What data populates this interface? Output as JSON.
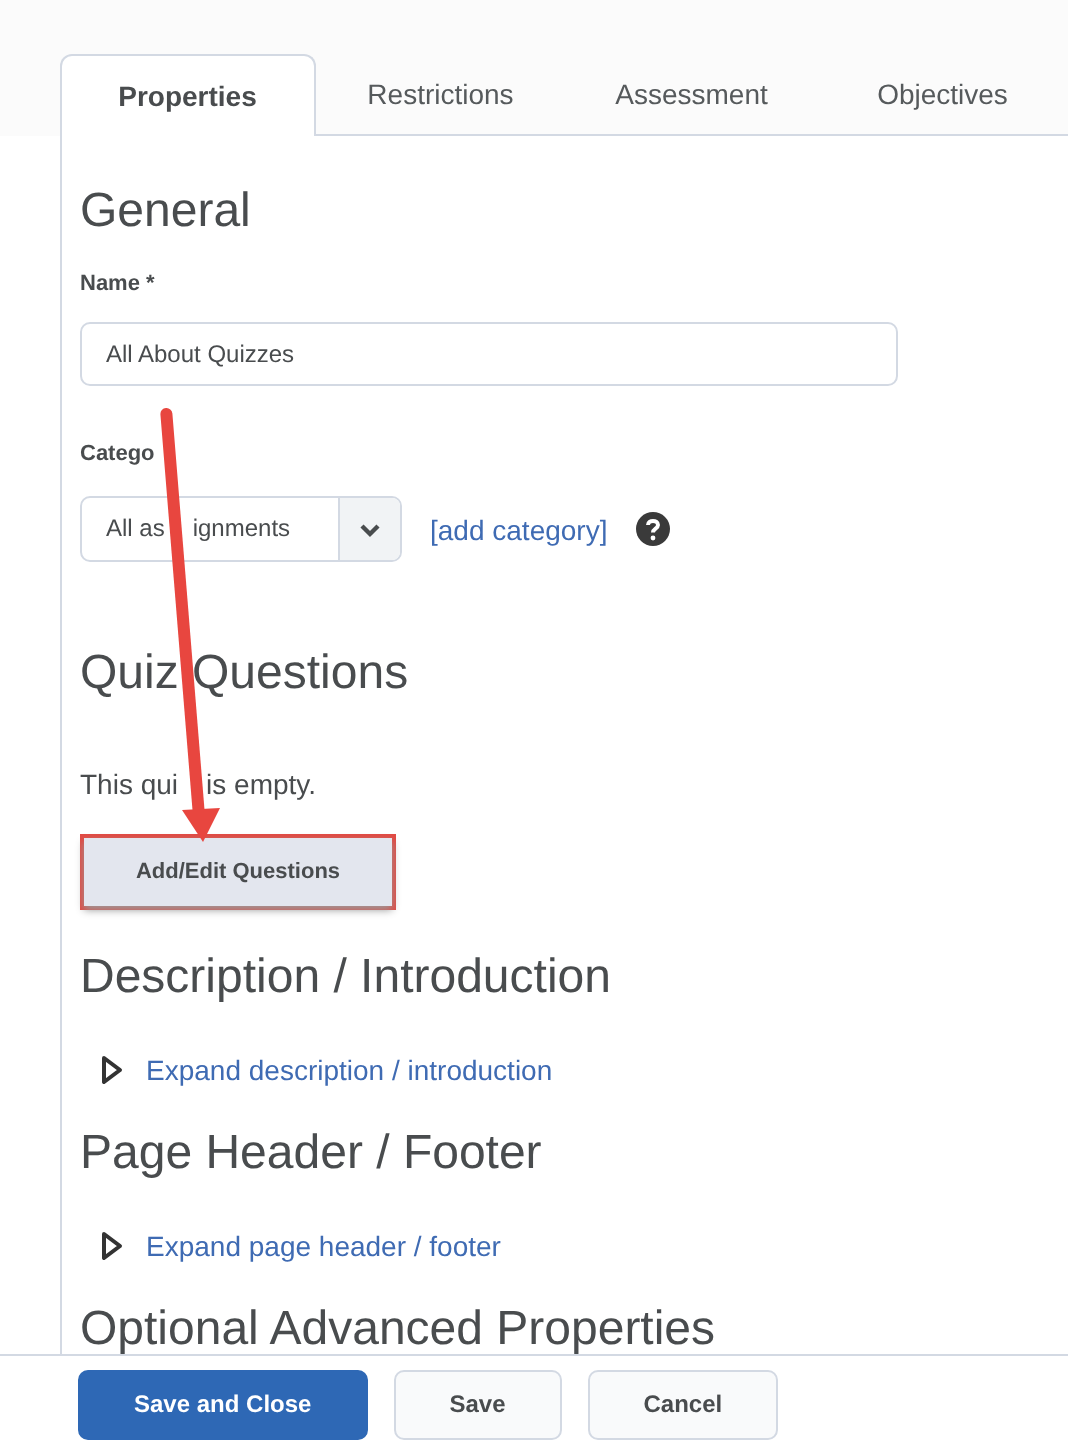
{
  "tabs": [
    {
      "label": "Properties",
      "selected": true
    },
    {
      "label": "Restrictions",
      "selected": false
    },
    {
      "label": "Assessment",
      "selected": false
    },
    {
      "label": "Objectives",
      "selected": false
    }
  ],
  "general": {
    "heading": "General",
    "name_label": "Name *",
    "name_value": "All About Quizzes",
    "category_label": "Catego",
    "category_value_parts": [
      "All as",
      "ignments"
    ],
    "add_category": "[add category]"
  },
  "quiz_questions": {
    "heading": "Quiz Questions",
    "empty_text_parts": [
      "This qui",
      "is empty."
    ],
    "button": "Add/Edit Questions"
  },
  "sections": [
    {
      "heading": "Description / Introduction",
      "link": "Expand description / introduction",
      "expanded": false
    },
    {
      "heading": "Page Header / Footer",
      "link": "Expand page header / footer",
      "expanded": false
    }
  ],
  "last_heading": "Optional Advanced Properties",
  "footer_buttons": [
    {
      "label": "Save and Close",
      "kind": "primary"
    },
    {
      "label": "Save",
      "kind": "secondary"
    },
    {
      "label": "Cancel",
      "kind": "secondary"
    }
  ]
}
